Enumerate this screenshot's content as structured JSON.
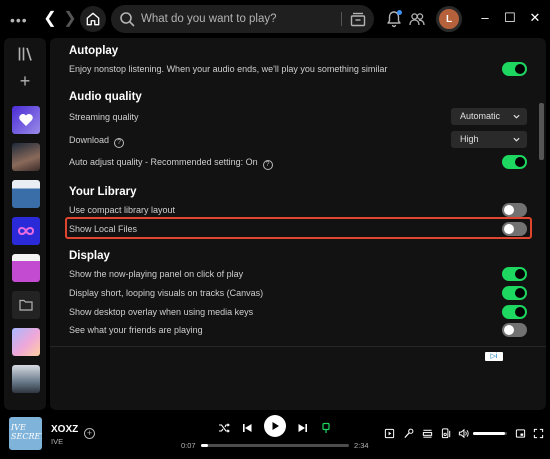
{
  "topbar": {
    "search_placeholder": "What do you want to play?",
    "avatar_initial": "L",
    "window_controls": [
      "–",
      "☐",
      "✕"
    ]
  },
  "settings": {
    "autoplay": {
      "title": "Autoplay",
      "rows": [
        {
          "label": "Enjoy nonstop listening. When your audio ends, we'll play you something similar",
          "on": true
        }
      ]
    },
    "audio_quality": {
      "title": "Audio quality",
      "streaming_label": "Streaming quality",
      "streaming_value": "Automatic",
      "download_label": "Download",
      "download_value": "High",
      "auto_adjust_label": "Auto adjust quality - Recommended setting: On",
      "auto_adjust_on": true
    },
    "your_library": {
      "title": "Your Library",
      "rows": [
        {
          "label": "Use compact library layout",
          "on": false
        },
        {
          "label": "Show Local Files",
          "on": false
        }
      ]
    },
    "display": {
      "title": "Display",
      "rows": [
        {
          "label": "Show the now-playing panel on click of play",
          "on": true
        },
        {
          "label": "Display short, looping visuals on tracks (Canvas)",
          "on": true
        },
        {
          "label": "Show desktop overlay when using media keys",
          "on": true
        },
        {
          "label": "See what your friends are playing",
          "on": false
        }
      ]
    }
  },
  "player": {
    "cover_text": "IVE SECRET",
    "track_title": "XOXZ",
    "artist": "IVE",
    "elapsed": "0:07",
    "duration": "2:34",
    "progress_fraction": 0.045,
    "volume_fraction": 0.95
  },
  "colors": {
    "accent": "#1ed760",
    "highlight_border": "#e0452f",
    "panel": "#121212"
  }
}
